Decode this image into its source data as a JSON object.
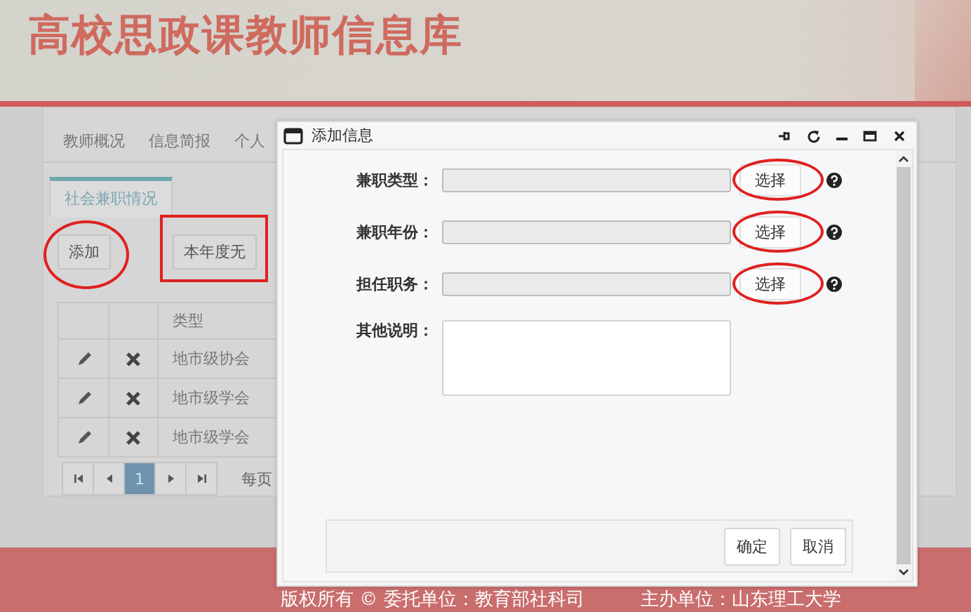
{
  "header": {
    "title": "高校思政课教师信息库"
  },
  "nav": [
    {
      "label": "教师概况"
    },
    {
      "label": "信息简报"
    },
    {
      "label": "个人"
    }
  ],
  "tabs": [
    {
      "label": "社会兼职情况",
      "selected": true
    }
  ],
  "toolbar": [
    {
      "label": "添加",
      "circled": true,
      "boxed": false
    },
    {
      "label": "本年度无",
      "circled": false,
      "boxed": true
    }
  ],
  "table": {
    "columns": [
      "类型"
    ],
    "rows": [
      {
        "type": "地市级协会"
      },
      {
        "type": "地市级学会"
      },
      {
        "type": "地市级学会"
      }
    ]
  },
  "pagination": {
    "pages": [
      {
        "label": "1",
        "selected": true
      }
    ],
    "page_size_label": "每页"
  },
  "dialog": {
    "title": "添加信息",
    "fields": [
      {
        "kind": "select",
        "label": "兼职类型：",
        "button": "选择",
        "circled": true
      },
      {
        "kind": "select",
        "label": "兼职年份：",
        "button": "选择",
        "circled": true
      },
      {
        "kind": "select",
        "label": "担任职务：",
        "button": "选择",
        "circled": true
      },
      {
        "kind": "textarea",
        "label": "其他说明："
      }
    ],
    "buttons": [
      "确定",
      "取消"
    ]
  },
  "footer": {
    "texts": [
      "版权所有 © 委托单位：教育部社科司",
      "主办单位：山东理工大学"
    ]
  }
}
